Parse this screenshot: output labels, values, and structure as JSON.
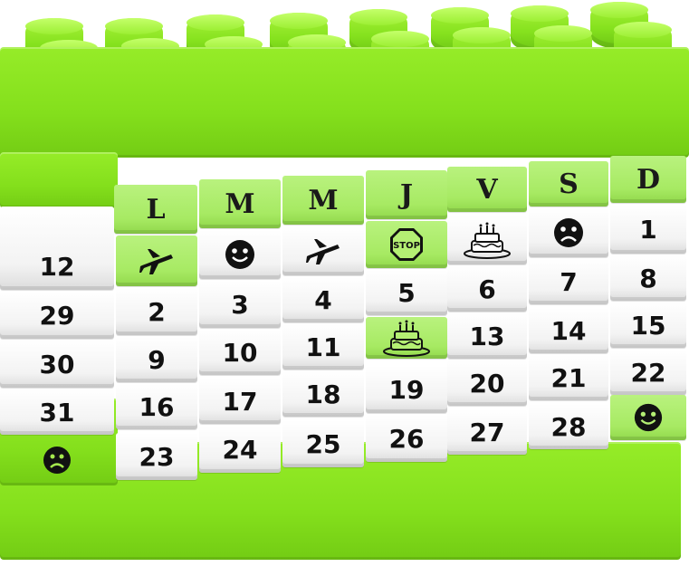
{
  "calendar": {
    "weekday_headers": [
      "L",
      "M",
      "M",
      "J",
      "V",
      "S",
      "D"
    ],
    "stop_sign_text": "STOP",
    "first_column_numbers": [
      "12",
      "29",
      "30",
      "31"
    ],
    "day_numbers": {
      "d1": "1",
      "d2": "2",
      "d3": "3",
      "d4": "4",
      "d5": "5",
      "d6": "6",
      "d7": "7",
      "d8": "8",
      "d9": "9",
      "d10": "10",
      "d11": "11",
      "d13": "13",
      "d14": "14",
      "d15": "15",
      "d16": "16",
      "d17": "17",
      "d18": "18",
      "d19": "19",
      "d20": "20",
      "d21": "21",
      "d22": "22",
      "d23": "23",
      "d24": "24",
      "d25": "25",
      "d26": "26",
      "d27": "27",
      "d28": "28"
    },
    "colors": {
      "block_green": "#86e21e",
      "light_green_tile": "#a7ea63",
      "white_tile": "#ffffff",
      "ink": "#111111"
    },
    "icons": [
      "airplane-icon",
      "smiley-icon",
      "airplane-icon",
      "stop-sign-icon",
      "birthday-cake-icon",
      "sad-face-icon",
      "birthday-cake-icon",
      "smiley-icon",
      "sad-face-icon"
    ]
  }
}
